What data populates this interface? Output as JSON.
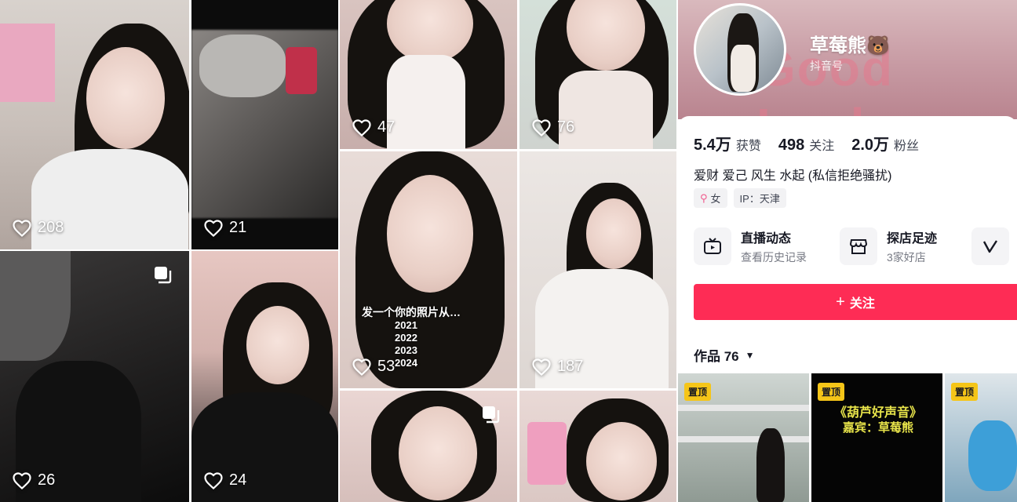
{
  "feed": {
    "tiles": [
      {
        "likes": "208"
      },
      {
        "likes": "21"
      },
      {
        "likes": "47"
      },
      {
        "likes": "76"
      },
      {
        "likes": "26"
      },
      {
        "likes": "24"
      },
      {
        "likes": "53",
        "overlay_text": "发一个你的照片从…",
        "years": [
          "2021",
          "2022",
          "2023",
          "2024"
        ]
      },
      {
        "likes": "187"
      }
    ]
  },
  "profile": {
    "name": "草莓熊🐻",
    "douyin_id_label": "抖音号",
    "banner_text": "Good Luck",
    "stats": [
      {
        "value": "5.4万",
        "label": "获赞"
      },
      {
        "value": "498",
        "label": "关注"
      },
      {
        "value": "2.0万",
        "label": "粉丝"
      }
    ],
    "bio": "爱财 爱己 风生 水起 (私信拒绝骚扰)",
    "gender_tag": "女",
    "ip_tag": "IP：天津",
    "features": [
      {
        "title": "直播动态",
        "subtitle": "查看历史记录",
        "icon": "tv-icon"
      },
      {
        "title": "探店足迹",
        "subtitle": "3家好店",
        "icon": "store-icon"
      }
    ],
    "follow_label": "关注",
    "works_label": "作品 76",
    "pinned_badge": "置顶",
    "pinned_caption_line1": "《葫芦好声音》",
    "pinned_caption_line2": "嘉宾：草莓熊"
  },
  "colors": {
    "accent": "#fe2c55",
    "pin": "#f5c518"
  }
}
